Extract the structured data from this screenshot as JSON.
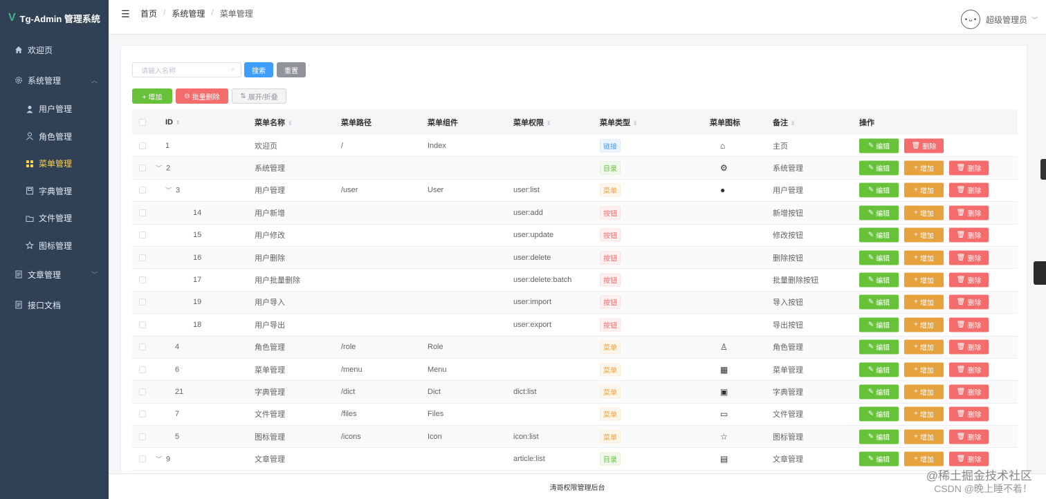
{
  "sidebar": {
    "logo": "Tg-Admin 管理系统",
    "items": [
      {
        "label": "欢迎页",
        "icon": "home-icon"
      },
      {
        "label": "系统管理",
        "icon": "gear-icon"
      },
      {
        "label": "用户管理",
        "icon": "user-icon"
      },
      {
        "label": "角色管理",
        "icon": "user-outline-icon"
      },
      {
        "label": "菜单管理",
        "icon": "grid-icon"
      },
      {
        "label": "字典管理",
        "icon": "notebook-icon"
      },
      {
        "label": "文件管理",
        "icon": "folder-icon"
      },
      {
        "label": "图标管理",
        "icon": "star-icon"
      },
      {
        "label": "文章管理",
        "icon": "document-icon"
      },
      {
        "label": "接口文档",
        "icon": "document-icon"
      }
    ]
  },
  "header": {
    "breadcrumb": [
      "首页",
      "系统管理",
      "菜单管理"
    ],
    "username": "超级管理员"
  },
  "search": {
    "placeholder": "请输入名称",
    "search_label": "搜索",
    "reset_label": "重置"
  },
  "toolbar": {
    "add_label": "+ 增加",
    "batch_delete_label": "批量删除",
    "expand_label": "展开/折叠"
  },
  "table": {
    "columns": [
      "ID",
      "菜单名称",
      "菜单路径",
      "菜单组件",
      "菜单权限",
      "菜单类型",
      "菜单图标",
      "备注",
      "操作"
    ],
    "rows": [
      {
        "id": "1",
        "name": "欢迎页",
        "path": "/",
        "component": "Index",
        "perm": "",
        "type": "链接",
        "type_color": "blue",
        "icon": "home-icon",
        "icon_glyph": "⌂",
        "remark": "主页",
        "level": 0,
        "expand": "",
        "edit": "编辑",
        "add": "",
        "del": "删除"
      },
      {
        "id": "2",
        "name": "系统管理",
        "path": "",
        "component": "",
        "perm": "",
        "type": "目录",
        "type_color": "green",
        "icon": "gear-icon",
        "icon_glyph": "⚙",
        "remark": "系统管理",
        "level": 0,
        "expand": "﹀",
        "edit": "编辑",
        "add": "增加",
        "del": "删除"
      },
      {
        "id": "3",
        "name": "用户管理",
        "path": "/user",
        "component": "User",
        "perm": "user:list",
        "type": "菜单",
        "type_color": "orange",
        "icon": "user-icon",
        "icon_glyph": "●",
        "remark": "用户管理",
        "level": 1,
        "expand": "﹀",
        "edit": "编辑",
        "add": "增加",
        "del": "删除"
      },
      {
        "id": "14",
        "name": "用户新增",
        "path": "",
        "component": "",
        "perm": "user:add",
        "type": "按钮",
        "type_color": "red",
        "icon": "",
        "icon_glyph": "",
        "remark": "新增按钮",
        "level": 2,
        "expand": "",
        "edit": "编辑",
        "add": "增加",
        "del": "删除"
      },
      {
        "id": "15",
        "name": "用户修改",
        "path": "",
        "component": "",
        "perm": "user:update",
        "type": "按钮",
        "type_color": "red",
        "icon": "",
        "icon_glyph": "",
        "remark": "修改按钮",
        "level": 2,
        "expand": "",
        "edit": "编辑",
        "add": "增加",
        "del": "删除"
      },
      {
        "id": "16",
        "name": "用户删除",
        "path": "",
        "component": "",
        "perm": "user:delete",
        "type": "按钮",
        "type_color": "red",
        "icon": "",
        "icon_glyph": "",
        "remark": "删除按钮",
        "level": 2,
        "expand": "",
        "edit": "编辑",
        "add": "增加",
        "del": "删除"
      },
      {
        "id": "17",
        "name": "用户批量删除",
        "path": "",
        "component": "",
        "perm": "user:delete:batch",
        "type": "按钮",
        "type_color": "red",
        "icon": "",
        "icon_glyph": "",
        "remark": "批量删除按钮",
        "level": 2,
        "expand": "",
        "edit": "编辑",
        "add": "增加",
        "del": "删除"
      },
      {
        "id": "19",
        "name": "用户导入",
        "path": "",
        "component": "",
        "perm": "user:import",
        "type": "按钮",
        "type_color": "red",
        "icon": "",
        "icon_glyph": "",
        "remark": "导入按钮",
        "level": 2,
        "expand": "",
        "edit": "编辑",
        "add": "增加",
        "del": "删除"
      },
      {
        "id": "18",
        "name": "用户导出",
        "path": "",
        "component": "",
        "perm": "user:export",
        "type": "按钮",
        "type_color": "red",
        "icon": "",
        "icon_glyph": "",
        "remark": "导出按钮",
        "level": 2,
        "expand": "",
        "edit": "编辑",
        "add": "增加",
        "del": "删除"
      },
      {
        "id": "4",
        "name": "角色管理",
        "path": "/role",
        "component": "Role",
        "perm": "",
        "type": "菜单",
        "type_color": "orange",
        "icon": "user-outline-icon",
        "icon_glyph": "♙",
        "remark": "角色管理",
        "level": 1,
        "expand": "",
        "edit": "编辑",
        "add": "增加",
        "del": "删除"
      },
      {
        "id": "6",
        "name": "菜单管理",
        "path": "/menu",
        "component": "Menu",
        "perm": "",
        "type": "菜单",
        "type_color": "orange",
        "icon": "grid-icon",
        "icon_glyph": "▦",
        "remark": "菜单管理",
        "level": 1,
        "expand": "",
        "edit": "编辑",
        "add": "增加",
        "del": "删除"
      },
      {
        "id": "21",
        "name": "字典管理",
        "path": "/dict",
        "component": "Dict",
        "perm": "dict:list",
        "type": "菜单",
        "type_color": "orange",
        "icon": "notebook-icon",
        "icon_glyph": "▣",
        "remark": "字典管理",
        "level": 1,
        "expand": "",
        "edit": "编辑",
        "add": "增加",
        "del": "删除"
      },
      {
        "id": "7",
        "name": "文件管理",
        "path": "/files",
        "component": "Files",
        "perm": "",
        "type": "菜单",
        "type_color": "orange",
        "icon": "folder-icon",
        "icon_glyph": "▭",
        "remark": "文件管理",
        "level": 1,
        "expand": "",
        "edit": "编辑",
        "add": "增加",
        "del": "删除"
      },
      {
        "id": "5",
        "name": "图标管理",
        "path": "/icons",
        "component": "Icon",
        "perm": "icon:list",
        "type": "菜单",
        "type_color": "orange",
        "icon": "star-icon",
        "icon_glyph": "☆",
        "remark": "图标管理",
        "level": 1,
        "expand": "",
        "edit": "编辑",
        "add": "增加",
        "del": "删除"
      },
      {
        "id": "9",
        "name": "文章管理",
        "path": "",
        "component": "",
        "perm": "article:list",
        "type": "目录",
        "type_color": "green",
        "icon": "document-icon",
        "icon_glyph": "▤",
        "remark": "文章管理",
        "level": 0,
        "expand": "﹀",
        "edit": "编辑",
        "add": "增加",
        "del": "删除"
      }
    ]
  },
  "footer": {
    "text": "涛哥权限管理后台"
  },
  "watermark": {
    "line1": "@稀土掘金技术社区",
    "line2": "CSDN @晚上睡不着！"
  }
}
